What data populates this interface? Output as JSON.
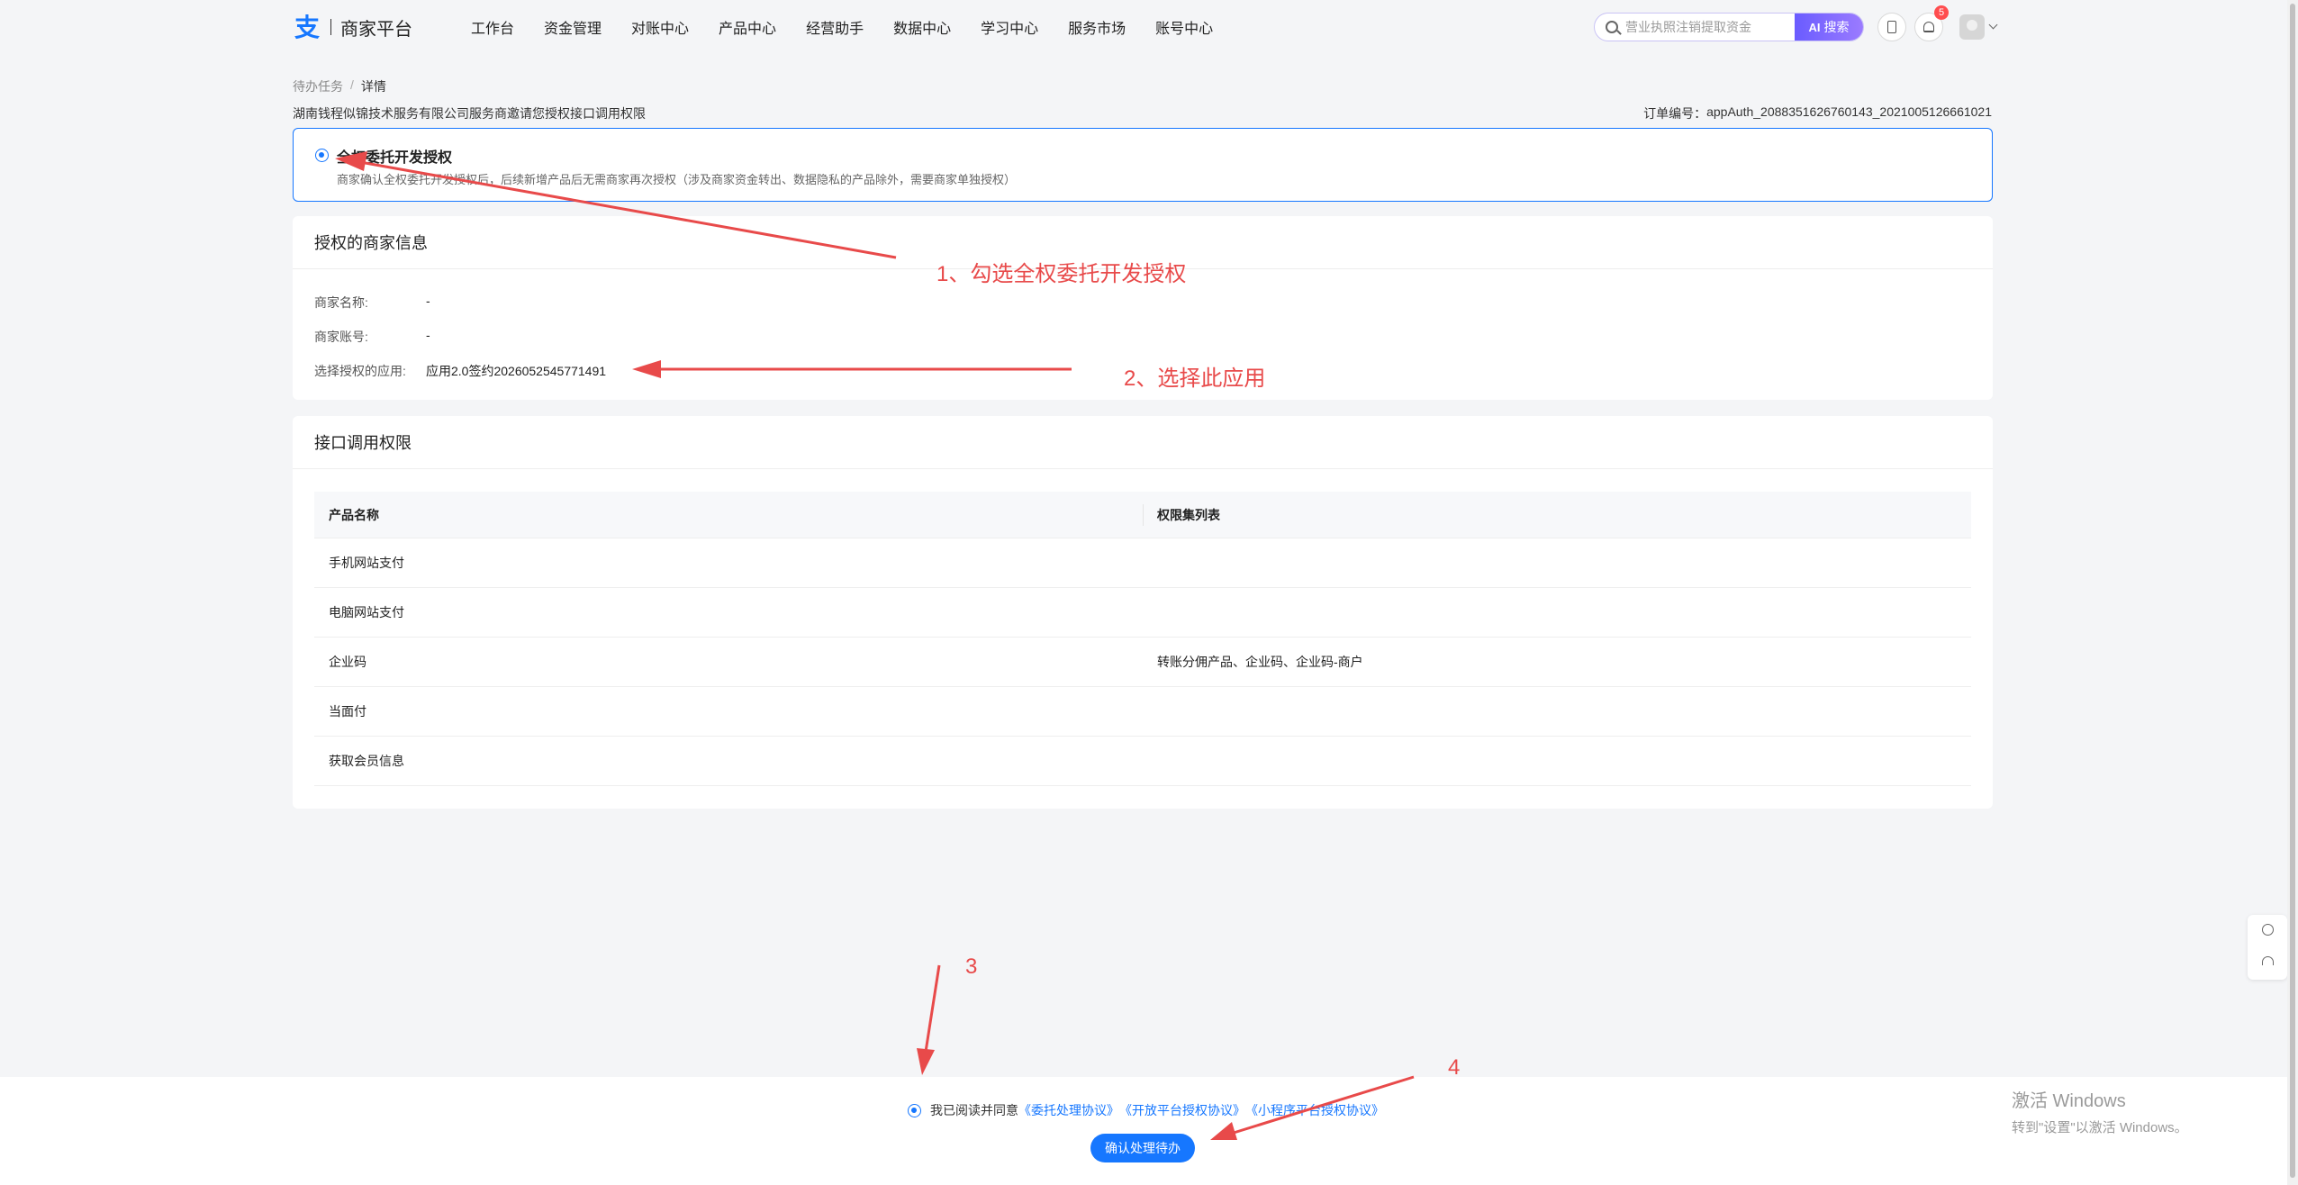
{
  "colors": {
    "accent": "#1677ff",
    "annotation": "#e84a4a",
    "background": "#f4f5f7"
  },
  "header": {
    "logo_text": "商家平台",
    "nav": [
      "工作台",
      "资金管理",
      "对账中心",
      "产品中心",
      "经营助手",
      "数据中心",
      "学习中心",
      "服务市场",
      "账号中心"
    ],
    "search": {
      "placeholder": "营业执照注销提取资金",
      "button": "搜索",
      "button_icon": "AI"
    },
    "notification_count": "5"
  },
  "breadcrumb": {
    "parent": "待办任务",
    "separator": "/",
    "current": "详情"
  },
  "page_desc": "湖南钱程似锦技术服务有限公司服务商邀请您授权接口调用权限",
  "order": {
    "label": "订单编号：",
    "value": "appAuth_2088351626760143_2021005126661021"
  },
  "option": {
    "title": "全权委托开发授权",
    "desc": "商家确认全权委托开发授权后，后续新增产品后无需商家再次授权（涉及商家资金转出、数据隐私的产品除外，需要商家单独授权）"
  },
  "merchant_info": {
    "title": "授权的商家信息",
    "rows": [
      {
        "label": "商家名称:",
        "value": "-"
      },
      {
        "label": "商家账号:",
        "value": "-"
      },
      {
        "label": "选择授权的应用:",
        "value": "应用2.0签约2026052545771491"
      }
    ]
  },
  "permissions": {
    "title": "接口调用权限",
    "headers": [
      "产品名称",
      "权限集列表"
    ],
    "rows": [
      {
        "name": "手机网站支付",
        "perms": ""
      },
      {
        "name": "电脑网站支付",
        "perms": ""
      },
      {
        "name": "企业码",
        "perms": "转账分佣产品、企业码、企业码-商户"
      },
      {
        "name": "当面付",
        "perms": ""
      },
      {
        "name": "获取会员信息",
        "perms": ""
      }
    ]
  },
  "annotations": [
    "1、勾选全权委托开发授权",
    "2、选择此应用",
    "3",
    "4"
  ],
  "footer": {
    "agree_prefix": "我已阅读并同意",
    "links": [
      "《委托处理协议》",
      "《开放平台授权协议》",
      "《小程序平台授权协议》"
    ],
    "confirm": "确认处理待办"
  },
  "watermark": {
    "title": "激活 Windows",
    "sub": "转到\"设置\"以激活 Windows。"
  }
}
